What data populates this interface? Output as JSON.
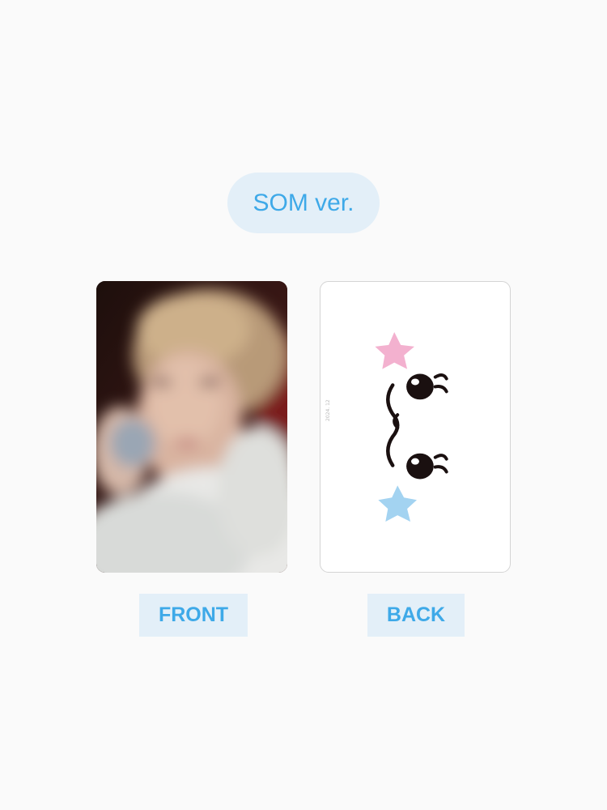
{
  "version_label": "SOM ver.",
  "cards": {
    "front": {
      "label": "FRONT",
      "image": "blurred-portrait-photo"
    },
    "back": {
      "label": "BACK",
      "image": "emoticon-face-with-stars",
      "side_text": "2024. 12"
    }
  },
  "colors": {
    "background": "#fafafa",
    "pill_background": "#e3eff8",
    "accent_text": "#3ea9e8",
    "pink_star": "#f3b1cf",
    "blue_star": "#a3d3f1",
    "face_ink": "#1a1010"
  }
}
